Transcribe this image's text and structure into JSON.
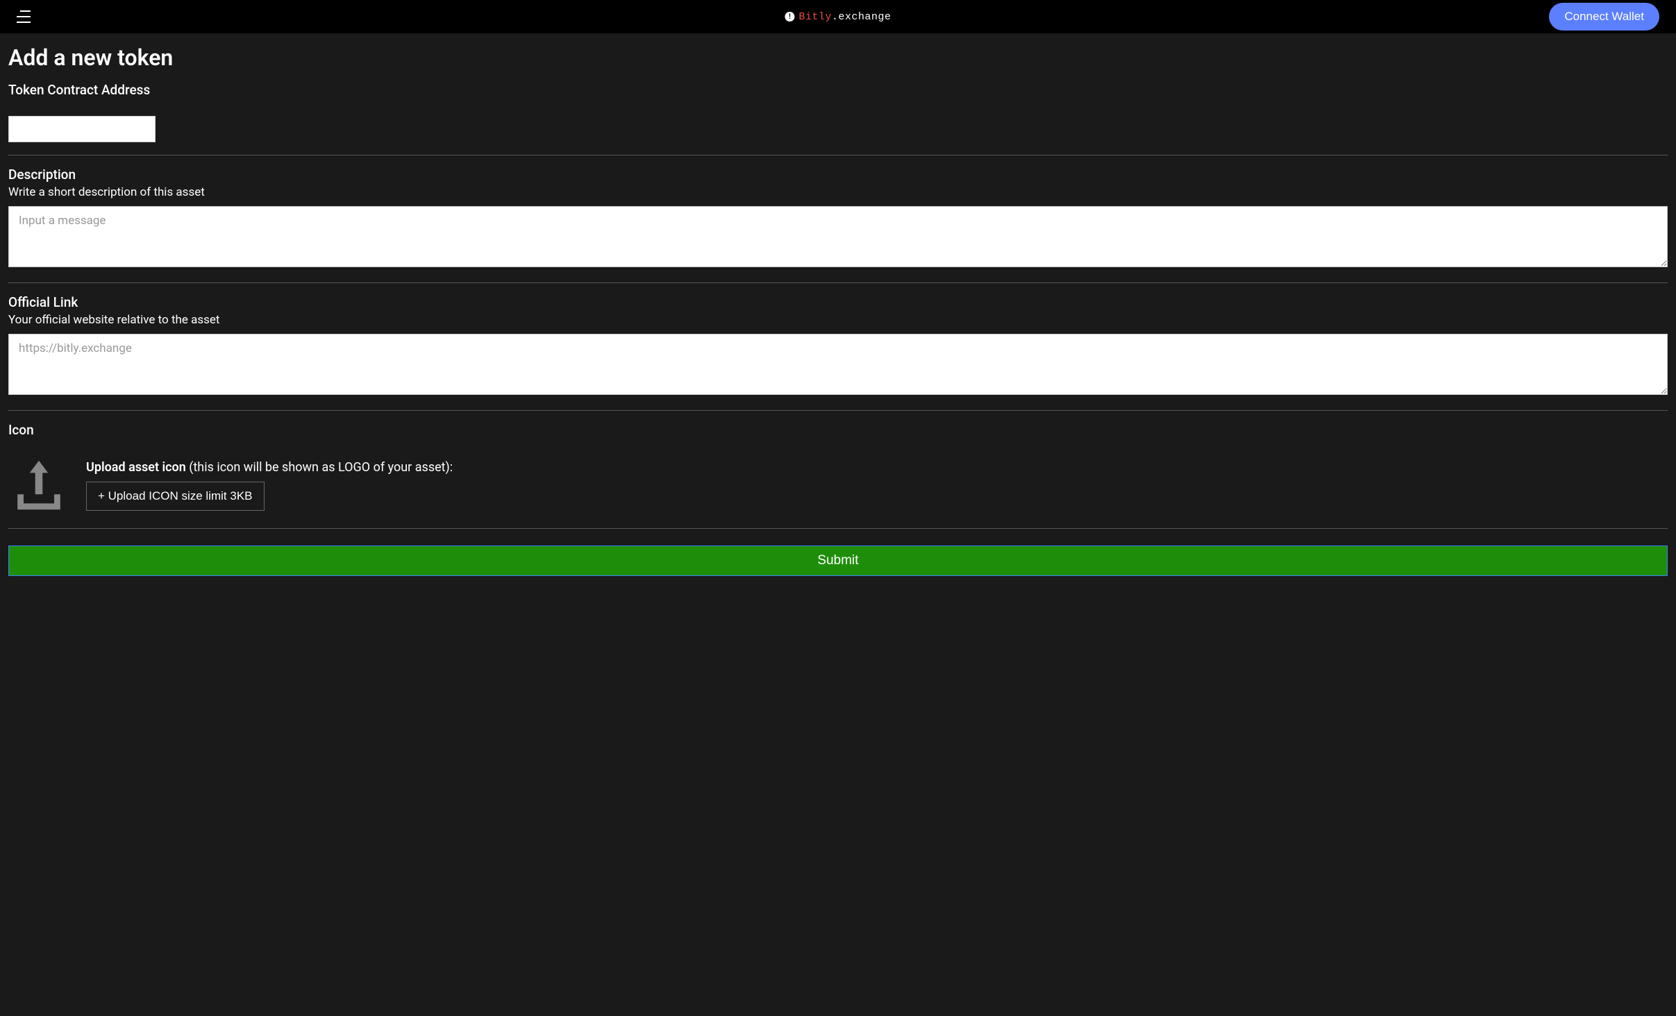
{
  "header": {
    "logo_bitly": "Bitly",
    "logo_exchange": ".exchange",
    "connect_label": "Connect Wallet"
  },
  "page": {
    "title": "Add a new token"
  },
  "form": {
    "contract": {
      "label": "Token Contract Address",
      "value": ""
    },
    "description": {
      "label": "Description",
      "sublabel": "Write a short description of this asset",
      "placeholder": "Input a message",
      "value": ""
    },
    "official_link": {
      "label": "Official Link",
      "sublabel": "Your official website relative to the asset",
      "placeholder": "https://bitly.exchange",
      "value": ""
    },
    "icon": {
      "label": "Icon",
      "upload_label_bold": "Upload asset icon",
      "upload_label_rest": " (this icon will be shown as LOGO of your asset):",
      "upload_button": "+ Upload ICON size limit 3KB"
    },
    "submit_label": "Submit"
  }
}
